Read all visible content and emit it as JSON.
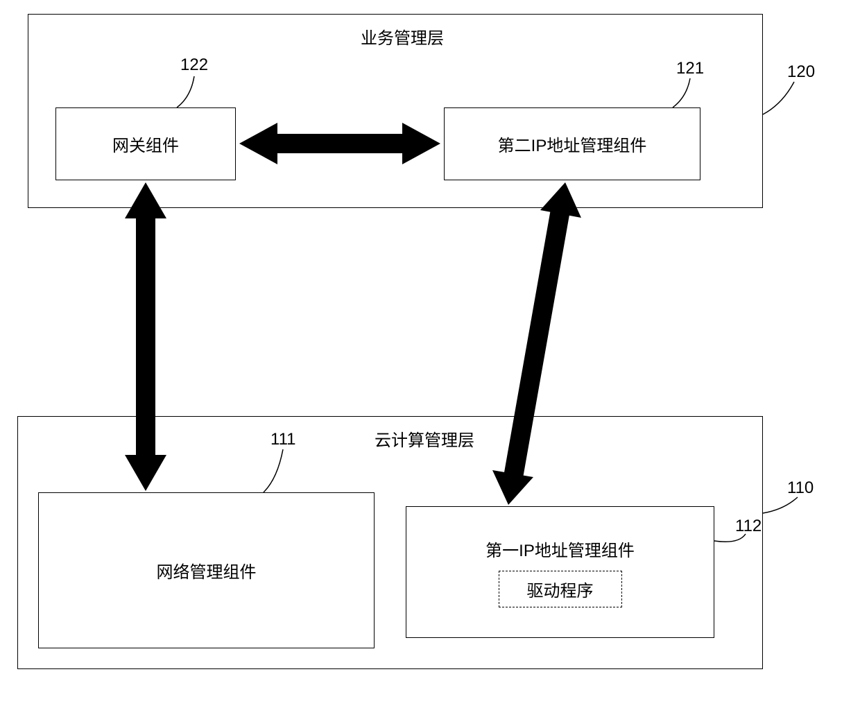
{
  "layers": {
    "top": {
      "title": "业务管理层",
      "ref": "120"
    },
    "bottom": {
      "title": "云计算管理层",
      "ref": "110"
    }
  },
  "components": {
    "gateway": {
      "label": "网关组件",
      "ref": "122"
    },
    "second_ip": {
      "label": "第二IP地址管理组件",
      "ref": "121"
    },
    "network_mgmt": {
      "label": "网络管理组件",
      "ref": "111"
    },
    "first_ip": {
      "label": "第一IP地址管理组件",
      "driver_label": "驱动程序",
      "ref": "112"
    }
  }
}
